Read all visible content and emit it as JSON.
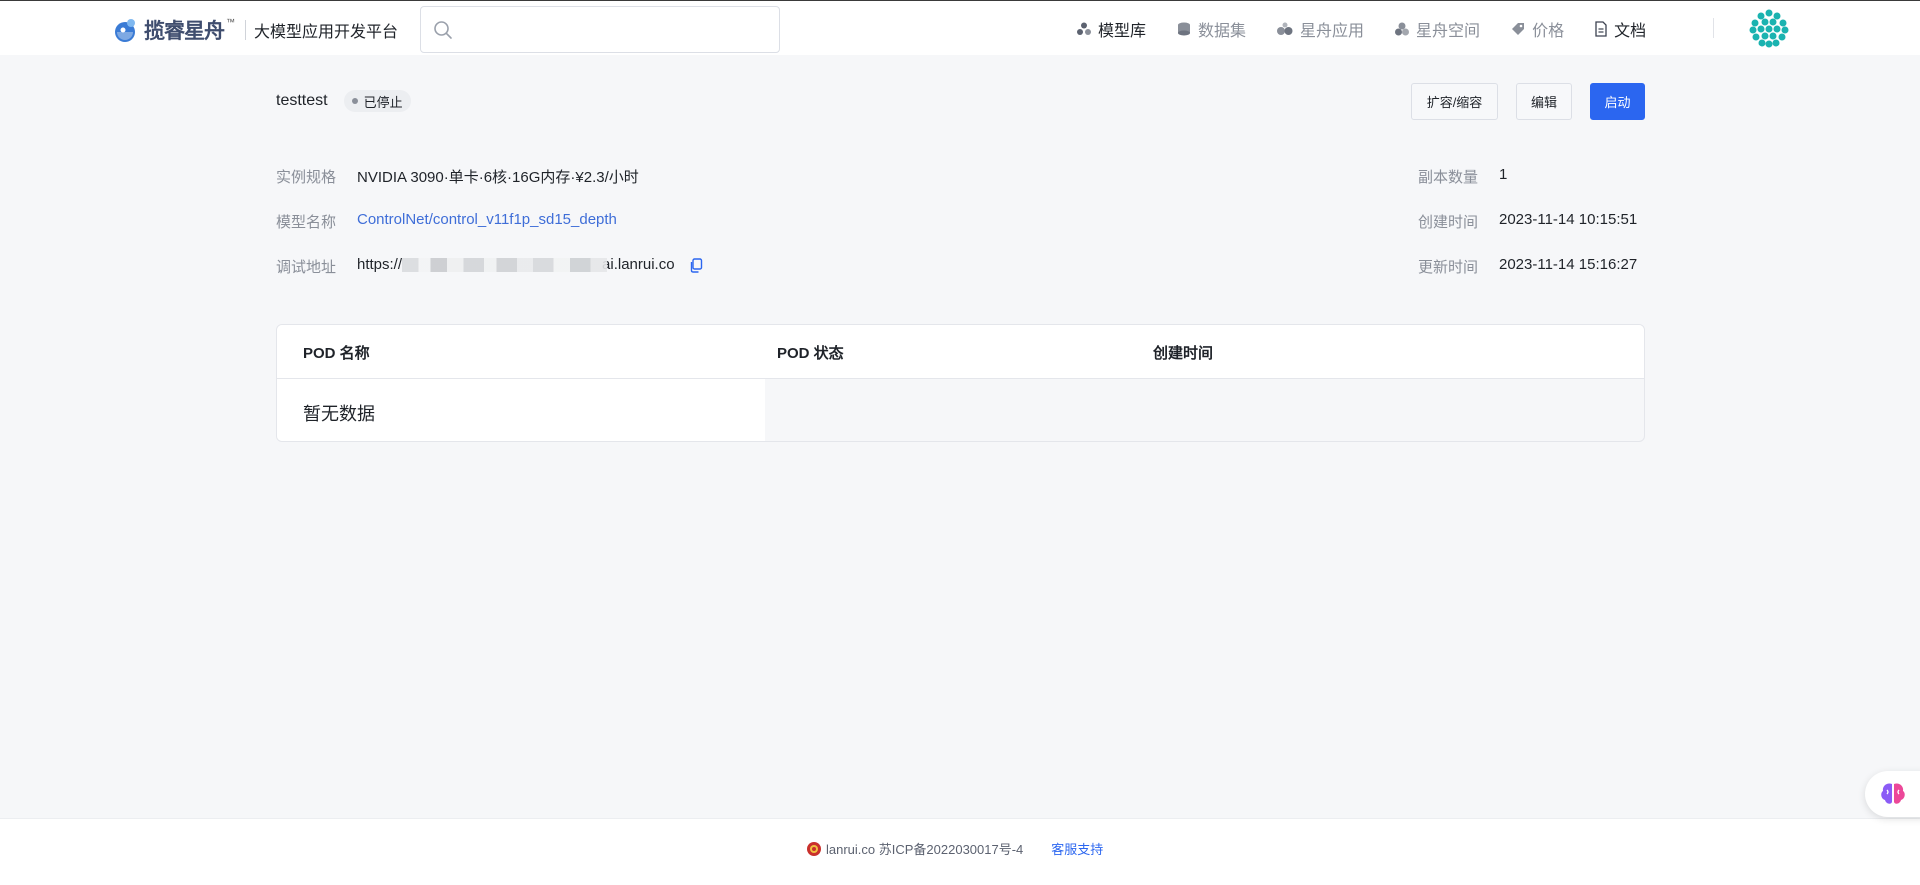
{
  "header": {
    "logo_text": "揽睿星舟",
    "logo_tm": "™",
    "platform_name": "大模型应用开发平台",
    "search": {
      "placeholder": "",
      "value": ""
    },
    "nav": [
      {
        "label": "模型库",
        "icon": "model-library-icon"
      },
      {
        "label": "数据集",
        "icon": "dataset-icon"
      },
      {
        "label": "星舟应用",
        "icon": "apps-icon"
      },
      {
        "label": "星舟空间",
        "icon": "space-icon"
      },
      {
        "label": "价格",
        "icon": "price-tag-icon"
      },
      {
        "label": "文档",
        "icon": "document-icon"
      }
    ]
  },
  "instance": {
    "name": "testtest",
    "status": "已停止",
    "actions": {
      "scale": "扩容/缩容",
      "edit": "编辑",
      "start": "启动"
    },
    "left": [
      {
        "label": "实例规格",
        "value": "NVIDIA 3090·单卡·6核·16G内存·¥2.3/小时"
      },
      {
        "label": "模型名称",
        "value": "ControlNet/control_v11f1p_sd15_depth"
      },
      {
        "label": "调试地址",
        "value_prefix": "https://",
        "value_suffix": "ai.lanrui.co"
      }
    ],
    "right": [
      {
        "label": "副本数量",
        "value": "1"
      },
      {
        "label": "创建时间",
        "value": "2023-11-14 10:15:51"
      },
      {
        "label": "更新时间",
        "value": "2023-11-14 15:16:27"
      }
    ]
  },
  "table": {
    "columns": [
      "POD 名称",
      "POD 状态",
      "创建时间"
    ],
    "empty_text": "暂无数据"
  },
  "footer": {
    "icp": "lanrui.co 苏ICP备2022030017号-4",
    "support": "客服支持"
  },
  "colors": {
    "primary": "#2b66f0",
    "link": "#3f6ed8",
    "background": "#f6f7f9"
  }
}
